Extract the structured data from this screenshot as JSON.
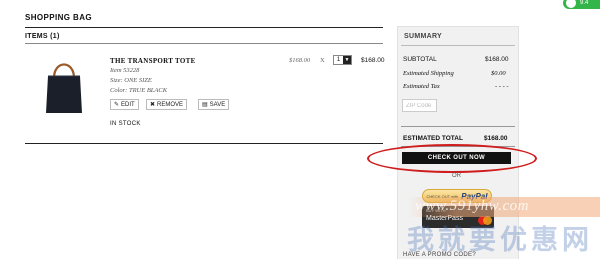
{
  "page": {
    "title": "SHOPPING BAG"
  },
  "items_header": "ITEMS (1)",
  "item": {
    "name": "THE TRANSPORT TOTE",
    "item_no": "Item 53228",
    "size": "Size: ONE SIZE",
    "color": "Color: TRUE BLACK",
    "unit_price": "$168.00",
    "times": "X",
    "quantity": "1",
    "line_total": "$168.00",
    "stock_status": "IN STOCK",
    "actions": {
      "edit": "EDIT",
      "remove": "REMOVE",
      "save": "SAVE"
    }
  },
  "summary": {
    "title": "SUMMARY",
    "subtotal_label": "SUBTOTAL",
    "subtotal": "$168.00",
    "shipping_label": "Estimated Shipping",
    "shipping": "$0.00",
    "tax_label": "Estimated Tax",
    "tax": "- - - -",
    "zip_placeholder": "ZIP Code",
    "total_label": "ESTIMATED TOTAL",
    "total": "$168.00",
    "checkout_label": "CHECK OUT NOW",
    "or_label": "OR",
    "paypal_small": "CHECK OUT with",
    "paypal_brand": "PayPal",
    "masterpass_small": "BUY WITH",
    "masterpass_brand": "MasterPass",
    "promo_label": "HAVE A PROMO CODE?"
  },
  "toggle": {
    "text": "9.4"
  },
  "watermark": {
    "url": "www.591yhw.com",
    "cn": "我就要优惠网"
  },
  "colors": {
    "accent_red": "#d01c1c",
    "checkout_bg": "#111111",
    "summary_bg": "#f1f1f1",
    "paypal_gold": "#f0c45c",
    "toggle_green": "#34b54a"
  }
}
